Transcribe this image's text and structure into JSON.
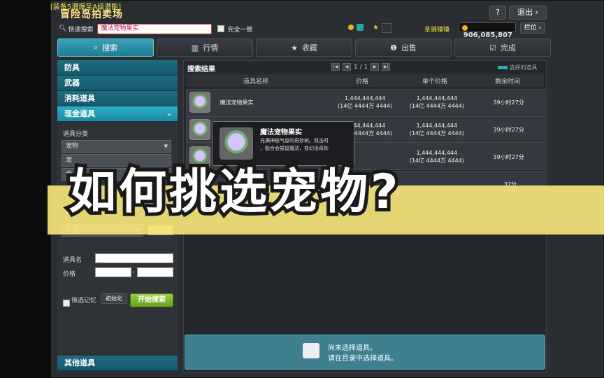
{
  "top_note": "[装备5潜爆至A级潜能]",
  "window_title": "冒险岛拍卖场",
  "help_label": "?",
  "exit_label": "退出 ›",
  "search": {
    "label": "快速搜索",
    "value": "魔法宠物果实",
    "exact_match_label": "完全一致"
  },
  "wallet": {
    "maple_points_label": "圣骑锤锤",
    "mesos": "906,085,807",
    "storage_label": "栏位 ›"
  },
  "tabs": [
    {
      "label": "搜索",
      "icon": "search-icon"
    },
    {
      "label": "行情",
      "icon": "chart-icon"
    },
    {
      "label": "收藏",
      "icon": "star-icon"
    },
    {
      "label": "出售",
      "icon": "coin-icon"
    },
    {
      "label": "完成",
      "icon": "check-icon"
    }
  ],
  "sidebar": {
    "categories": [
      "防具",
      "武器",
      "消耗道具",
      "现金道具"
    ],
    "item_category_label": "道具分类",
    "item_category_value": "宠物",
    "dropdowns_extra": [
      "宠",
      "全",
      "不选"
    ],
    "item_name_label": "道具名",
    "price_label": "价格",
    "price_sep": "-",
    "memory_label": "筛选记忆",
    "reset_label": "初始化",
    "start_label": "开始搜索",
    "other_items": "其他道具"
  },
  "results": {
    "title": "搜索结果",
    "page": "1 / 1",
    "selected_label": "选择的道具",
    "columns": [
      "道具名称",
      "价格",
      "单个价格",
      "剩余时间"
    ],
    "rows": [
      {
        "name": "魔法宠物果实",
        "price": "1,444,444,444",
        "price_sub": "(14亿 4444万 4444)",
        "unit": "1,444,444,444",
        "unit_sub": "(14亿 4444万 4444)",
        "time": "39小时27分"
      },
      {
        "name": "",
        "price": "1,444,444,444",
        "price_sub": "(14亿 4444万 4444)",
        "unit": "1,444,444,444",
        "unit_sub": "(14亿 4444万 4444)",
        "time": "39小时27分"
      },
      {
        "name": "",
        "price": "",
        "price_sub": "",
        "unit": "1,444,444,444",
        "unit_sub": "(14亿 4444万 4444)",
        "time": "39小时27分"
      },
      {
        "name": "",
        "price": "",
        "price_sub": "",
        "unit": "",
        "unit_sub": "",
        "time": "37分"
      }
    ]
  },
  "tooltip": {
    "title": "魔法宠物果实",
    "line1": "充满神秘气息的奇妙树。双击时",
    "line2": "，能合会猫鼠魔法，变幻出奇妙"
  },
  "empty": {
    "line1": "尚未选择道具。",
    "line2": "请在目录中选择道具。"
  },
  "overlay_text": "如何挑选宠物?"
}
